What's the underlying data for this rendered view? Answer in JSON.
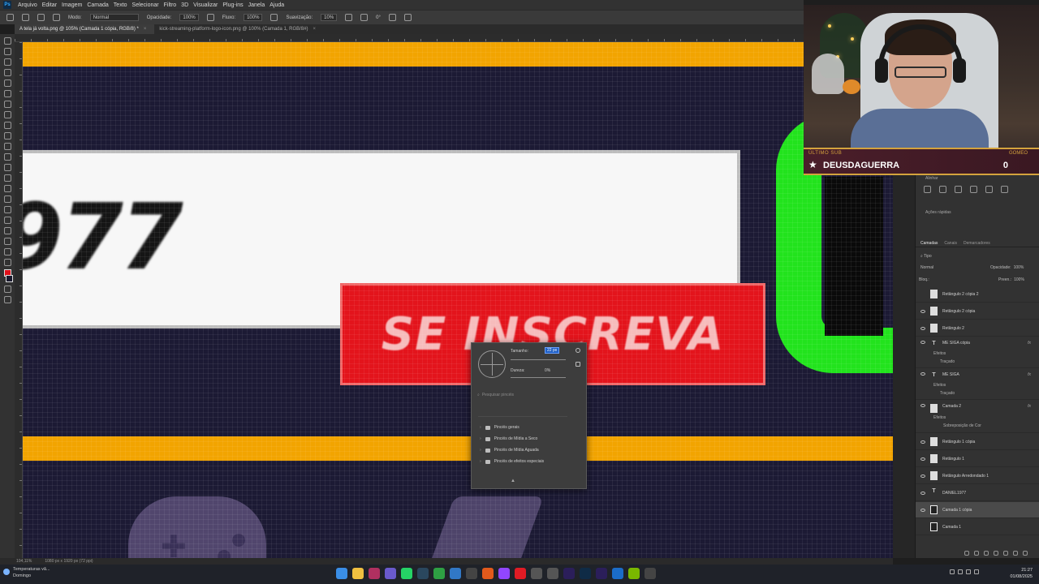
{
  "menubar": {
    "items": [
      "Arquivo",
      "Editar",
      "Imagem",
      "Camada",
      "Texto",
      "Selecionar",
      "Filtro",
      "3D",
      "Visualizar",
      "Plug-ins",
      "Janela",
      "Ajuda"
    ]
  },
  "options": {
    "mode_label": "Modo:",
    "mode_value": "Normal",
    "opacity_label": "Opacidade:",
    "opacity_value": "100%",
    "flow_label": "Fluxo:",
    "flow_value": "100%",
    "smoothing_label": "Suavização:",
    "smoothing_value": "10%",
    "angle_value": "0°"
  },
  "tabs": [
    {
      "label": "A tela já volta.png @ 105% (Camada 1 cópia, RGB/8) *"
    },
    {
      "label": "kick-streaming-platform-logo-icon.png @ 100% (Camada 1, RGB/8#)"
    }
  ],
  "canvas": {
    "number_text": "977",
    "button_text": "SE INSCREVA"
  },
  "brush_picker": {
    "size_label": "Tamanho:",
    "size_value": "22 px",
    "hardness_label": "Dureza:",
    "hardness_value": "0%",
    "search_placeholder": "Pesquisar pincéis",
    "folders": [
      "Pincéis gerais",
      "Pincéis de Mídia a Seco",
      "Pincéis de Mídia Aguada",
      "Pincéis de efeitos especiais"
    ]
  },
  "properties": {
    "tab_label": "Alinhar",
    "quick_actions": "Ações rápidas"
  },
  "layers_panel": {
    "tabs": [
      "Camadas",
      "Canais",
      "Demarcadores"
    ],
    "filter_label": "Tipo",
    "blend_mode": "Normal",
    "opacity_label": "Opacidade:",
    "opacity_value": "100%",
    "lock_label": "Bloq.:",
    "fill_label": "Preen.:",
    "fill_value": "100%",
    "layers": [
      {
        "name": "Retângulo 2 cópia 2",
        "kind": "shape"
      },
      {
        "name": "Retângulo 2 cópia",
        "kind": "shape"
      },
      {
        "name": "Retângulo 2",
        "kind": "shape"
      },
      {
        "name": "ME SIGA cópia",
        "kind": "text",
        "fx": true
      },
      {
        "name": "ME SIGA",
        "kind": "text",
        "fx": true
      },
      {
        "name": "Camada 2",
        "kind": "shape",
        "fx": true
      },
      {
        "name": "Retângulo 1 cópia",
        "kind": "shape"
      },
      {
        "name": "Retângulo 1",
        "kind": "shape"
      },
      {
        "name": "Retângulo Arredondado 1",
        "kind": "shape"
      },
      {
        "name": "DANIEL1977",
        "kind": "text"
      },
      {
        "name": "Camada 1 cópia",
        "kind": "pixel",
        "selected": true
      },
      {
        "name": "Camada 1",
        "kind": "pixel"
      }
    ],
    "sublabels": {
      "effects": "Efeitos",
      "stroke": "Traçado",
      "color_overlay": "Sobreposição de Cor"
    }
  },
  "webcam": {
    "last_sub_label": "ÚLTIMO SUB",
    "last_sub_name": "DEUSDAGUERRA",
    "goal_label": "GOMEO",
    "goal_count": "0"
  },
  "statusbar": {
    "zoom": "104,11%",
    "doc_info": "1080 px x 1920 px (72 ppi)"
  },
  "taskbar": {
    "weather_title": "Temperaturas vã...",
    "weather_sub": "Domingo",
    "time": "21:27",
    "date": "01/08/2025"
  },
  "colors": {
    "foreground": "#e0101a",
    "accent_orange": "#f2a400",
    "accent_green": "#22e31d",
    "canvas_bg": "#1c1a34"
  }
}
